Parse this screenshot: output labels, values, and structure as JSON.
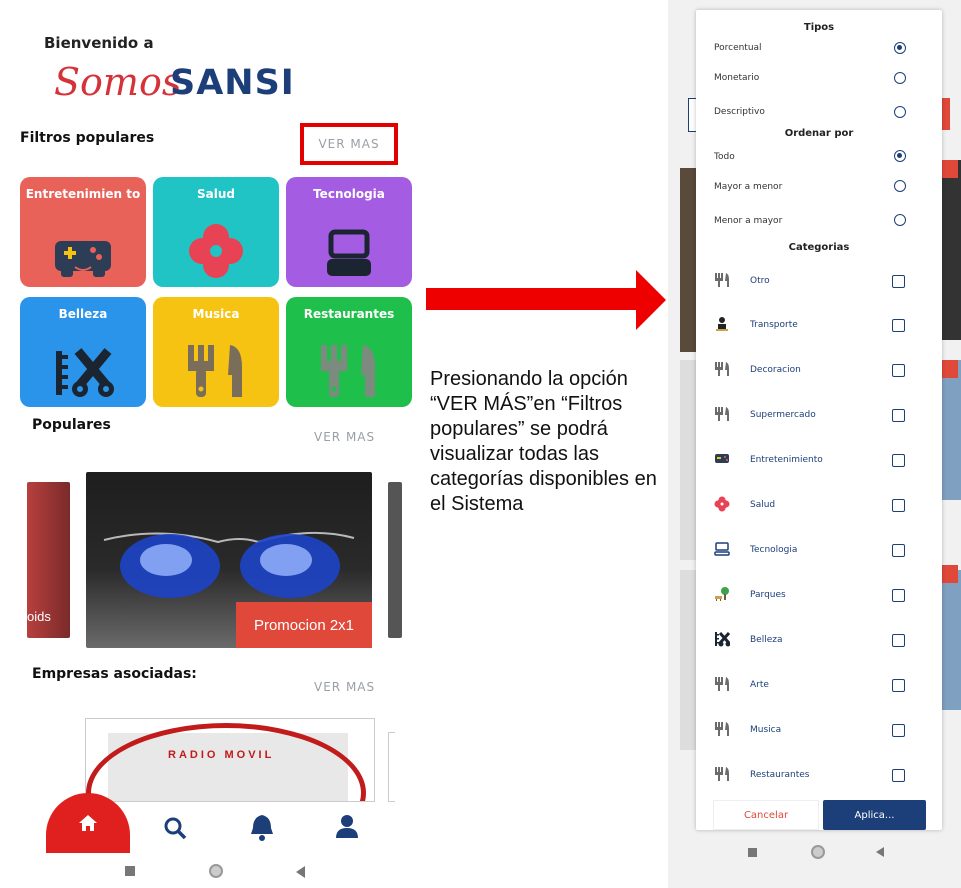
{
  "left_screen": {
    "welcome": "Bienvenido a",
    "logo_script": "Somos",
    "logo_bold": "SANSI",
    "popular_filters": {
      "title": "Filtros populares",
      "see_more": "VER MAS",
      "tiles": [
        {
          "label": "Entretenimien to",
          "color": "#e8625a",
          "icon": "gamepad-icon"
        },
        {
          "label": "Salud",
          "color": "#21c4c4",
          "icon": "flower-icon"
        },
        {
          "label": "Tecnologia",
          "color": "#a45ce3",
          "icon": "laptop-icon"
        },
        {
          "label": "Belleza",
          "color": "#2994e9",
          "icon": "comb-scissors-icon"
        },
        {
          "label": "Musica",
          "color": "#f7c313",
          "icon": "fork-knife-icon"
        },
        {
          "label": "Restaurantes",
          "color": "#1fbf4b",
          "icon": "fork-knife-icon"
        }
      ]
    },
    "populars": {
      "title": "Populares",
      "see_more": "VER MAS",
      "left_card_caption": "oids",
      "promo": "Promocion 2x1"
    },
    "partners": {
      "title": "Empresas asociadas:",
      "see_more": "VER MAS",
      "card_text": "RADIO MOVIL"
    },
    "nav": [
      "home-icon",
      "search-icon",
      "bell-icon",
      "user-icon"
    ],
    "accent": "#e0201f"
  },
  "annotation": "Presionando la opción “VER MÁS”en “Filtros populares” se podrá visualizar todas las categorías disponibles en el Sistema",
  "right_screen": {
    "types_title": "Tipos",
    "types": [
      {
        "label": "Porcentual",
        "selected": true
      },
      {
        "label": "Monetario",
        "selected": false
      },
      {
        "label": "Descriptivo",
        "selected": false
      }
    ],
    "order_title": "Ordenar por",
    "order": [
      {
        "label": "Todo",
        "selected": true
      },
      {
        "label": "Mayor a menor",
        "selected": false
      },
      {
        "label": "Menor a mayor",
        "selected": false
      }
    ],
    "categories_title": "Categorias",
    "categories": [
      {
        "label": "Otro",
        "icon": "fork-knife-icon"
      },
      {
        "label": "Transporte",
        "icon": "person-icon"
      },
      {
        "label": "Decoracion",
        "icon": "fork-knife-icon"
      },
      {
        "label": "Supermercado",
        "icon": "fork-knife-icon"
      },
      {
        "label": "Entretenimiento",
        "icon": "gamepad-icon"
      },
      {
        "label": "Salud",
        "icon": "flower-icon"
      },
      {
        "label": "Tecnologia",
        "icon": "laptop-icon"
      },
      {
        "label": "Parques",
        "icon": "park-icon"
      },
      {
        "label": "Belleza",
        "icon": "comb-scissors-icon"
      },
      {
        "label": "Arte",
        "icon": "fork-knife-icon"
      },
      {
        "label": "Musica",
        "icon": "fork-knife-icon"
      },
      {
        "label": "Restaurantes",
        "icon": "fork-knife-icon"
      }
    ],
    "cancel": "Cancelar",
    "apply": "Aplica...",
    "primary": "#1c3f7a"
  }
}
